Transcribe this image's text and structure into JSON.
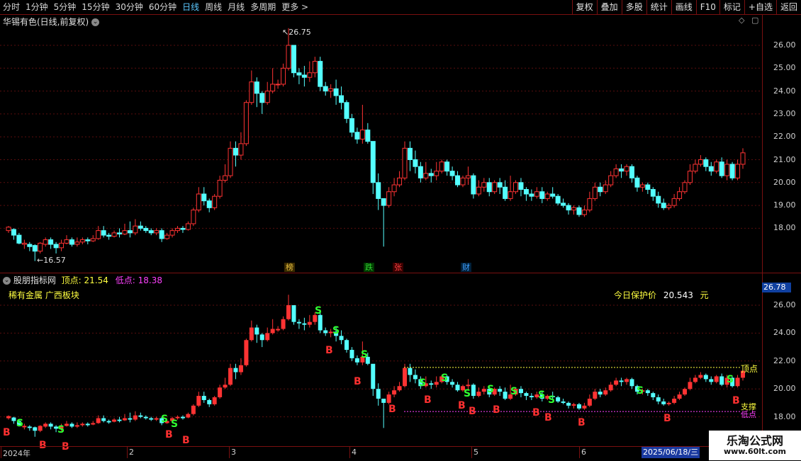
{
  "toolbar": {
    "periods": [
      "分时",
      "1分钟",
      "5分钟",
      "15分钟",
      "30分钟",
      "60分钟",
      "日线",
      "周线",
      "月线",
      "多周期",
      "更多 >"
    ],
    "active_period": "日线",
    "buttons": [
      "复权",
      "叠加",
      "多股",
      "统计",
      "画线",
      "F10",
      "标记",
      "+自选",
      "返回"
    ]
  },
  "main_panel": {
    "title": "华锡有色(日线,前复权)",
    "high_label": "26.75",
    "low_label": "16.57",
    "y_ticks": [
      "26.00",
      "25.00",
      "24.00",
      "23.00",
      "22.00",
      "21.00",
      "20.00",
      "19.00",
      "18.00"
    ],
    "event_tags": [
      {
        "text": "榜",
        "color": "#e8c040"
      },
      {
        "text": "跌",
        "color": "#30d030"
      },
      {
        "text": "张",
        "color": "#ff4040"
      },
      {
        "text": "财",
        "color": "#40a0ff"
      }
    ]
  },
  "indicator_panel": {
    "name": "股朋指标网",
    "top_label": "顶点:",
    "top_value": "21.54",
    "bottom_label": "低点:",
    "bottom_value": "18.38",
    "sector": "稀有金属 广西板块",
    "protect_label": "今日保护价",
    "protect_value": "20.543",
    "protect_unit": "元",
    "current_price": "26.78",
    "y_ticks": [
      "26.00",
      "24.00",
      "22.00",
      "20.00",
      "18.00"
    ],
    "line_top_text": "顶点",
    "line_support_text": "支撑",
    "line_bottom_text": "低点"
  },
  "date_axis": {
    "labels": [
      "2024年",
      "2",
      "3",
      "4",
      "5",
      "6"
    ],
    "current_date": "2025/06/18/三"
  },
  "watermark": {
    "line1": "乐淘公式网",
    "line2": "www.60lt.com"
  },
  "colors": {
    "up": "#ff3333",
    "down": "#54ffff",
    "border": "#7a1010",
    "signal_b": "#ff3030",
    "signal_s": "#30ff30"
  },
  "chart_data": {
    "type": "candlestick",
    "candles": [
      [
        17.9,
        18.05,
        17.8,
        18.1
      ],
      [
        17.95,
        17.7,
        17.5,
        18.0
      ],
      [
        17.7,
        17.35,
        17.3,
        17.8
      ],
      [
        17.3,
        17.35,
        17.1,
        17.5
      ],
      [
        17.3,
        17.2,
        17.0,
        17.4
      ],
      [
        17.25,
        17.0,
        16.57,
        17.3
      ],
      [
        17.0,
        17.35,
        16.9,
        17.4
      ],
      [
        17.3,
        17.5,
        17.2,
        17.6
      ],
      [
        17.5,
        17.3,
        17.1,
        17.6
      ],
      [
        17.3,
        17.15,
        16.9,
        17.4
      ],
      [
        17.15,
        17.35,
        17.0,
        17.5
      ],
      [
        17.35,
        17.5,
        17.3,
        17.7
      ],
      [
        17.5,
        17.3,
        17.2,
        17.6
      ],
      [
        17.3,
        17.4,
        17.2,
        17.6
      ],
      [
        17.4,
        17.5,
        17.3,
        17.6
      ],
      [
        17.5,
        17.45,
        17.3,
        17.6
      ],
      [
        17.45,
        17.55,
        17.4,
        17.7
      ],
      [
        17.55,
        17.9,
        17.5,
        18.1
      ],
      [
        17.9,
        17.7,
        17.6,
        18.1
      ],
      [
        17.7,
        17.65,
        17.5,
        17.8
      ],
      [
        17.65,
        17.8,
        17.6,
        17.9
      ],
      [
        17.8,
        17.75,
        17.6,
        18.0
      ],
      [
        17.75,
        17.9,
        17.7,
        18.2
      ],
      [
        17.9,
        17.8,
        17.6,
        18.3
      ],
      [
        17.8,
        18.1,
        17.7,
        18.4
      ],
      [
        18.1,
        18.0,
        17.9,
        18.3
      ],
      [
        18.0,
        17.9,
        17.8,
        18.1
      ],
      [
        17.9,
        17.8,
        17.7,
        18.0
      ],
      [
        17.8,
        17.9,
        17.7,
        18.0
      ],
      [
        17.9,
        17.55,
        17.4,
        18.0
      ],
      [
        17.55,
        17.7,
        17.5,
        17.8
      ],
      [
        17.7,
        17.9,
        17.6,
        18.0
      ],
      [
        17.9,
        18.0,
        17.8,
        18.1
      ],
      [
        18.0,
        17.95,
        17.8,
        18.1
      ],
      [
        17.95,
        18.2,
        17.9,
        18.3
      ],
      [
        18.2,
        18.8,
        18.1,
        18.9
      ],
      [
        18.8,
        19.5,
        18.7,
        19.8
      ],
      [
        19.5,
        19.2,
        19.0,
        19.8
      ],
      [
        19.2,
        18.9,
        18.7,
        19.3
      ],
      [
        18.9,
        19.4,
        18.8,
        19.5
      ],
      [
        19.4,
        20.1,
        19.3,
        20.3
      ],
      [
        20.1,
        20.3,
        20.0,
        20.8
      ],
      [
        20.3,
        21.5,
        20.2,
        21.8
      ],
      [
        21.5,
        21.2,
        20.7,
        21.8
      ],
      [
        21.2,
        21.7,
        21.0,
        22.2
      ],
      [
        21.7,
        23.5,
        21.6,
        23.6
      ],
      [
        23.5,
        24.4,
        23.4,
        24.9
      ],
      [
        24.4,
        23.9,
        23.3,
        24.6
      ],
      [
        23.9,
        23.5,
        23.0,
        24.0
      ],
      [
        23.5,
        24.0,
        23.4,
        24.4
      ],
      [
        24.0,
        24.3,
        23.9,
        25.0
      ],
      [
        24.3,
        24.3,
        24.1,
        24.5
      ],
      [
        24.3,
        25.0,
        24.2,
        25.2
      ],
      [
        25.0,
        26.0,
        24.9,
        26.75
      ],
      [
        26.0,
        24.8,
        24.6,
        26.0
      ],
      [
        24.8,
        24.7,
        24.3,
        25.0
      ],
      [
        24.7,
        24.6,
        24.2,
        25.1
      ],
      [
        24.6,
        24.8,
        24.4,
        25.3
      ],
      [
        24.8,
        25.3,
        24.6,
        25.5
      ],
      [
        25.3,
        24.2,
        24.0,
        25.5
      ],
      [
        24.2,
        24.0,
        23.8,
        24.4
      ],
      [
        24.0,
        24.1,
        23.7,
        24.3
      ],
      [
        24.1,
        23.8,
        23.4,
        24.5
      ],
      [
        23.8,
        23.5,
        23.2,
        24.2
      ],
      [
        23.5,
        22.8,
        22.6,
        23.6
      ],
      [
        22.8,
        22.2,
        22.0,
        23.0
      ],
      [
        22.2,
        21.9,
        21.7,
        22.4
      ],
      [
        21.9,
        22.3,
        21.7,
        23.4
      ],
      [
        22.3,
        21.8,
        21.7,
        22.6
      ],
      [
        21.8,
        20.0,
        19.5,
        20.5
      ],
      [
        20.0,
        19.3,
        18.8,
        20.4
      ],
      [
        19.3,
        19.0,
        17.2,
        19.3
      ],
      [
        19.0,
        19.6,
        18.9,
        19.8
      ],
      [
        19.6,
        19.9,
        19.4,
        20.2
      ],
      [
        19.9,
        20.2,
        19.8,
        20.5
      ],
      [
        20.2,
        21.5,
        20.1,
        21.8
      ],
      [
        21.5,
        21.0,
        20.5,
        21.8
      ],
      [
        21.0,
        20.7,
        20.4,
        21.4
      ],
      [
        20.7,
        20.2,
        20.0,
        20.9
      ],
      [
        20.2,
        20.4,
        20.1,
        20.9
      ],
      [
        20.4,
        20.3,
        20.0,
        20.6
      ],
      [
        20.3,
        20.5,
        20.1,
        20.9
      ],
      [
        20.5,
        20.9,
        20.4,
        21.0
      ],
      [
        20.9,
        20.5,
        20.3,
        21.0
      ],
      [
        20.5,
        20.3,
        20.1,
        20.7
      ],
      [
        20.3,
        19.9,
        19.8,
        20.5
      ],
      [
        19.9,
        20.2,
        19.8,
        20.3
      ],
      [
        20.2,
        20.3,
        19.9,
        20.7
      ],
      [
        20.3,
        19.5,
        19.3,
        20.4
      ],
      [
        19.5,
        19.8,
        19.4,
        20.1
      ],
      [
        19.8,
        20.0,
        19.6,
        20.2
      ],
      [
        20.0,
        19.6,
        19.4,
        20.2
      ],
      [
        19.6,
        20.0,
        19.5,
        20.1
      ],
      [
        20.0,
        19.8,
        19.5,
        20.2
      ],
      [
        19.8,
        19.3,
        19.2,
        20.1
      ],
      [
        19.3,
        19.6,
        19.2,
        20.3
      ],
      [
        19.6,
        20.0,
        19.5,
        20.1
      ],
      [
        20.0,
        19.7,
        19.4,
        20.2
      ],
      [
        19.7,
        19.5,
        19.2,
        19.8
      ],
      [
        19.5,
        19.4,
        19.2,
        19.7
      ],
      [
        19.4,
        19.6,
        19.3,
        19.8
      ],
      [
        19.6,
        19.3,
        19.1,
        19.8
      ],
      [
        19.3,
        19.5,
        19.2,
        19.6
      ],
      [
        19.5,
        19.4,
        19.3,
        19.8
      ],
      [
        19.4,
        19.1,
        19.0,
        19.5
      ],
      [
        19.1,
        19.0,
        18.9,
        19.3
      ],
      [
        19.0,
        18.8,
        18.6,
        19.1
      ],
      [
        18.8,
        18.9,
        18.6,
        19.0
      ],
      [
        18.9,
        18.6,
        18.5,
        19.0
      ],
      [
        18.6,
        18.8,
        18.5,
        19.0
      ],
      [
        18.8,
        19.3,
        18.7,
        19.6
      ],
      [
        19.3,
        19.8,
        19.2,
        20.0
      ],
      [
        19.8,
        19.6,
        19.4,
        20.0
      ],
      [
        19.6,
        19.9,
        19.5,
        20.1
      ],
      [
        19.9,
        20.3,
        19.8,
        20.5
      ],
      [
        20.3,
        20.6,
        20.2,
        20.8
      ],
      [
        20.6,
        20.5,
        20.2,
        20.8
      ],
      [
        20.5,
        20.7,
        20.3,
        20.8
      ],
      [
        20.7,
        20.2,
        20.0,
        20.8
      ],
      [
        20.2,
        19.8,
        19.6,
        20.3
      ],
      [
        19.8,
        19.9,
        19.6,
        20.0
      ],
      [
        19.9,
        19.7,
        19.5,
        20.0
      ],
      [
        19.7,
        19.4,
        19.2,
        19.8
      ],
      [
        19.4,
        19.1,
        18.9,
        19.6
      ],
      [
        19.1,
        18.9,
        18.8,
        19.3
      ],
      [
        18.9,
        19.0,
        18.8,
        19.1
      ],
      [
        19.0,
        19.3,
        18.9,
        19.5
      ],
      [
        19.3,
        19.6,
        19.2,
        19.8
      ],
      [
        19.6,
        20.0,
        19.5,
        20.1
      ],
      [
        20.0,
        20.5,
        19.9,
        20.8
      ],
      [
        20.5,
        20.8,
        20.4,
        21.0
      ],
      [
        20.8,
        21.0,
        20.7,
        21.2
      ],
      [
        21.0,
        20.7,
        20.5,
        21.1
      ],
      [
        20.7,
        20.5,
        20.3,
        20.9
      ],
      [
        20.5,
        20.9,
        20.4,
        21.0
      ],
      [
        20.9,
        20.3,
        20.2,
        21.1
      ],
      [
        20.3,
        20.8,
        20.1,
        21.0
      ],
      [
        20.8,
        20.2,
        20.1,
        20.9
      ],
      [
        20.2,
        20.8,
        20.1,
        21.0
      ],
      [
        20.8,
        21.3,
        20.6,
        21.5
      ]
    ],
    "ylim_main": [
      17.0,
      26.75
    ],
    "ylim_indicator": [
      17.6,
      27.0
    ]
  }
}
